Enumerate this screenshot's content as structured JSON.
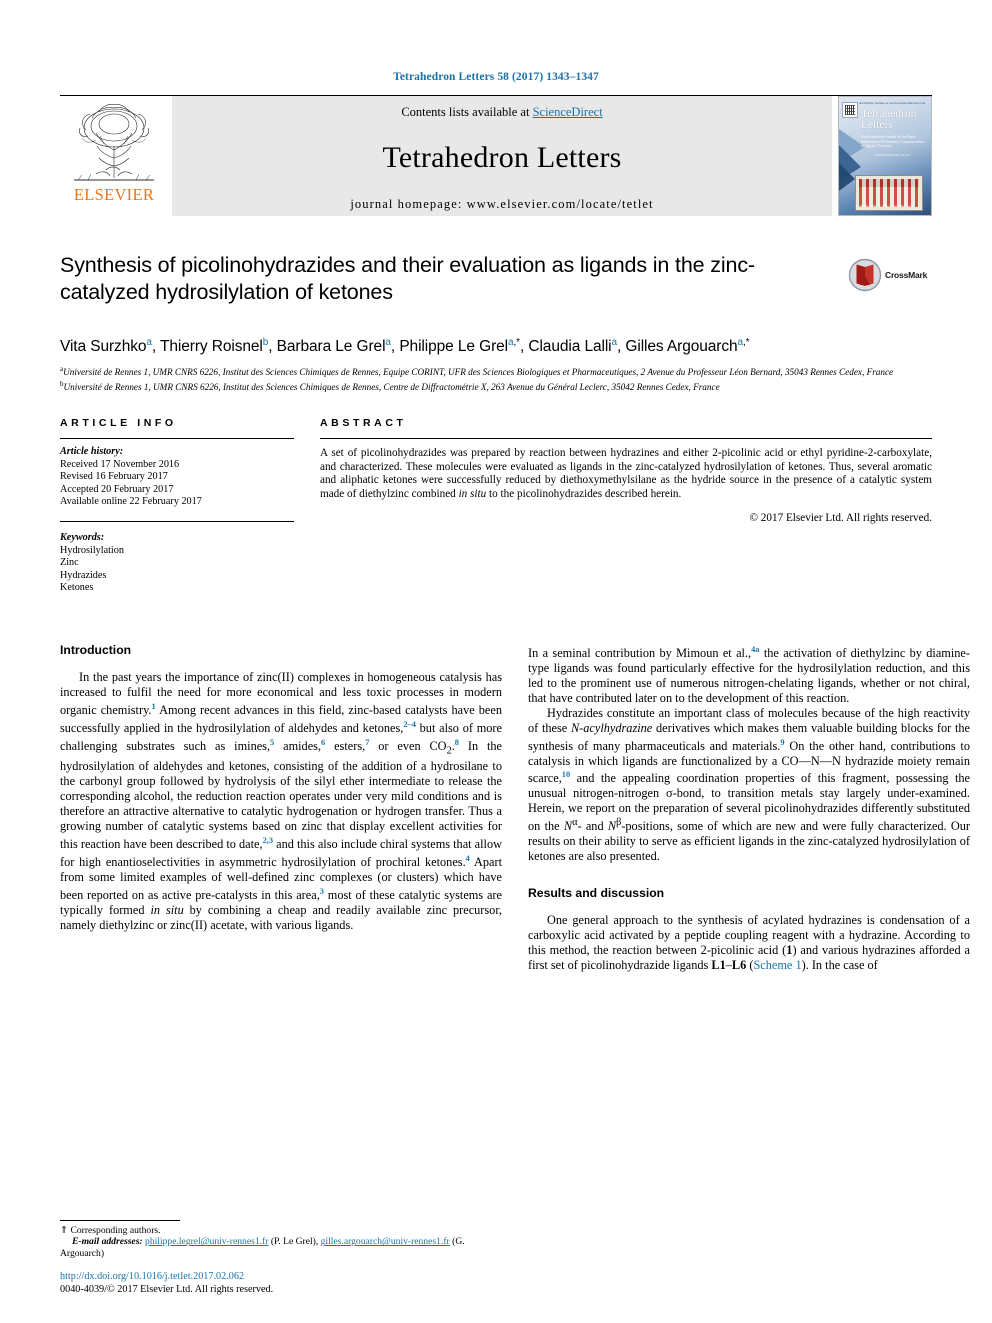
{
  "running_head": "Tetrahedron Letters 58 (2017) 1343–1347",
  "masthead": {
    "elsevier_wordmark": "ELSEVIER",
    "contents_prefix": "Contents lists available at ",
    "sciencedirect": "ScienceDirect",
    "journal_title": "Tetrahedron Letters",
    "homepage": "journal homepage: www.elsevier.com/locate/tetlet",
    "cover": {
      "title_line1": "Tetrahedron",
      "title_line2": "Letters",
      "top_strip": "Available online at www.sciencedirect.com",
      "sub": "An International Journal for the Rapid Publication of Preliminary Communications in Organic Chemistry",
      "sub2": "Volume 58   Number 14   2017",
      "foot": "Available online at www.sciencedirect.com"
    }
  },
  "article": {
    "title": "Synthesis of picolinohydrazides and their evaluation as ligands in the zinc-catalyzed hydrosilylation of ketones",
    "crossmark_label": "CrossMark",
    "authors": [
      {
        "name": "Vita Surzhko",
        "marks": "a",
        "star": false
      },
      {
        "name": "Thierry Roisnel",
        "marks": "b",
        "star": false
      },
      {
        "name": "Barbara Le Grel",
        "marks": "a",
        "star": false
      },
      {
        "name": "Philippe Le Grel",
        "marks": "a",
        "star": true
      },
      {
        "name": "Claudia Lalli",
        "marks": "a",
        "star": false
      },
      {
        "name": "Gilles Argouarch",
        "marks": "a",
        "star": true
      }
    ],
    "affiliations": [
      {
        "mark": "a",
        "text": "Université de Rennes 1, UMR CNRS 6226, Institut des Sciences Chimiques de Rennes, Equipe CORINT, UFR des Sciences Biologiques et Pharmaceutiques, 2 Avenue du Professeur Léon Bernard, 35043 Rennes Cedex, France"
      },
      {
        "mark": "b",
        "text": "Université de Rennes 1, UMR CNRS 6226, Institut des Sciences Chimiques de Rennes, Centre de Diffractométrie X, 263 Avenue du Général Leclerc, 35042 Rennes Cedex, France"
      }
    ]
  },
  "article_info": {
    "heading": "ARTICLE INFO",
    "history_label": "Article history:",
    "history": [
      "Received 17 November 2016",
      "Revised 16 February 2017",
      "Accepted 20 February 2017",
      "Available online 22 February 2017"
    ],
    "keywords_label": "Keywords:",
    "keywords": [
      "Hydrosilylation",
      "Zinc",
      "Hydrazides",
      "Ketones"
    ]
  },
  "abstract": {
    "heading": "ABSTRACT",
    "text": "A set of picolinohydrazides was prepared by reaction between hydrazines and either 2-picolinic acid or ethyl pyridine-2-carboxylate, and characterized. These molecules were evaluated as ligands in the zinc-catalyzed hydrosilylation of ketones. Thus, several aromatic and aliphatic ketones were successfully reduced by diethoxymethylsilane as the hydride source in the presence of a catalytic system made of diethylzinc combined in situ to the picolinohydrazides described herein.",
    "copyright": "© 2017 Elsevier Ltd. All rights reserved."
  },
  "sections": {
    "introduction_heading": "Introduction",
    "results_heading": "Results and discussion"
  },
  "body": {
    "left_p1": "In the past years the importance of zinc(II) complexes in homogeneous catalysis has increased to fulfil the need for more economical and less toxic processes in modern organic chemistry.1 Among recent advances in this field, zinc-based catalysts have been successfully applied in the hydrosilylation of aldehydes and ketones,2–4 but also of more challenging substrates such as imines,5 amides,6 esters,7 or even CO2.8 In the hydrosilylation of aldehydes and ketones, consisting of the addition of a hydrosilane to the carbonyl group followed by hydrolysis of the silyl ether intermediate to release the corresponding alcohol, the reduction reaction operates under very mild conditions and is therefore an attractive alternative to catalytic hydrogenation or hydrogen transfer. Thus a growing number of catalytic systems based on zinc that display excellent activities for this reaction have been described to date,2,3 and this also include chiral systems that allow for high enantioselectivities in asymmetric hydrosilylation of prochiral ketones.4 Apart from some limited examples of well-defined zinc complexes (or clusters) which have been reported on as active pre-catalysts in this area,3 most of these catalytic systems are typically formed in situ by combining a cheap and readily available zinc precursor, namely diethylzinc or zinc(II) acetate, with various ligands.",
    "right_p1_tail": "In a seminal contribution by Mimoun et al.,4a the activation of diethylzinc by diamine-type ligands was found particularly effective for the hydrosilylation reduction, and this led to the prominent use of numerous nitrogen-chelating ligands, whether or not chiral, that have contributed later on to the development of this reaction.",
    "right_p2": "Hydrazides constitute an important class of molecules because of the high reactivity of these N-acylhydrazine derivatives which makes them valuable building blocks for the synthesis of many pharmaceuticals and materials.9 On the other hand, contributions to catalysis in which ligands are functionalized by a CO—N—N hydrazide moiety remain scarce,10 and the appealing coordination properties of this fragment, possessing the unusual nitrogen-nitrogen σ-bond, to transition metals stay largely under-examined. Herein, we report on the preparation of several picolinohydrazides differently substituted on the Nα- and Nβ-positions, some of which are new and were fully characterized. Our results on their ability to serve as efficient ligands in the zinc-catalyzed hydrosilylation of ketones are also presented.",
    "right_p3": "One general approach to the synthesis of acylated hydrazines is condensation of a carboxylic acid activated by a peptide coupling reagent with a hydrazine. According to this method, the reaction between 2-picolinic acid (1) and various hydrazines afforded a first set of picolinohydrazide ligands L1–L6 (Scheme 1). In the case of"
  },
  "footnote": {
    "star": "⇑",
    "corresponding": "Corresponding authors.",
    "email_label": "E-mail addresses:",
    "email1": "philippe.legrel@univ-rennes1.fr",
    "email1_who": "(P. Le Grel)",
    "email2": "gilles.argouarch@univ-rennes1.fr",
    "email2_who": "(G. Argouarch)"
  },
  "bottom": {
    "doi": "http://dx.doi.org/10.1016/j.tetlet.2017.02.062",
    "issn_copyright": "0040-4039/© 2017 Elsevier Ltd. All rights reserved."
  },
  "colors": {
    "link_blue": "#1a74a8",
    "elsevier_orange": "#E87722",
    "banner_grey": "#e8e8e8"
  }
}
